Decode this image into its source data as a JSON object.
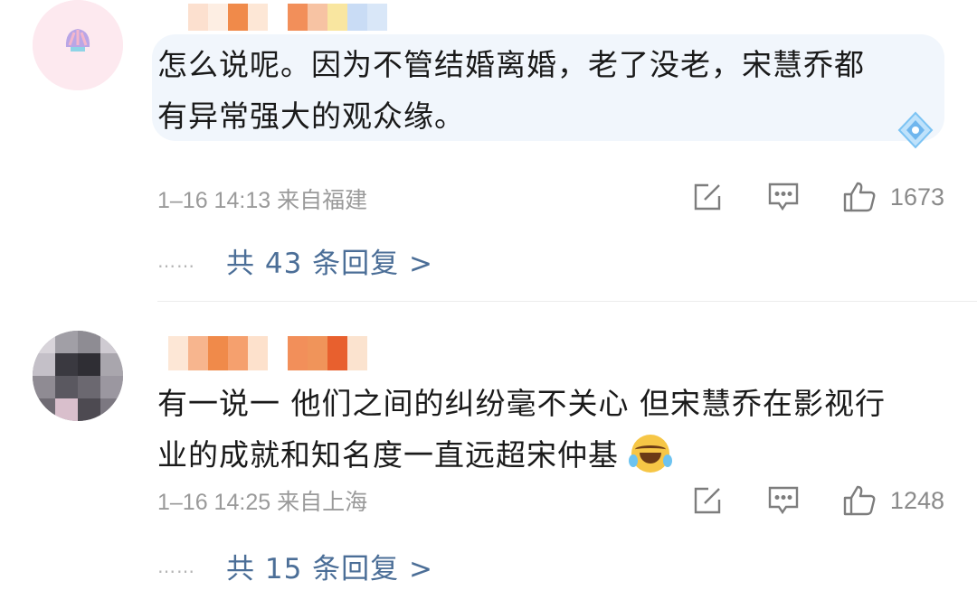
{
  "comments": [
    {
      "text_line1": "怎么说呢。因为不管结婚离婚，老了没老，宋慧乔都",
      "text_line2": "有异常强大的观众缘。",
      "meta": "1–16 14:13 来自福建",
      "likes": "1673",
      "replies": "共 43 条回复 >",
      "dots": "……"
    },
    {
      "text_line1": "有一说一 他们之间的纠纷毫不关心 但宋慧乔在影视行",
      "text_line2": "业的成就和知名度一直远超宋仲基",
      "meta": "1–16 14:25 来自上海",
      "likes": "1248",
      "replies": "共 15 条回复 >",
      "dots": "……"
    }
  ],
  "icons": {
    "repost": "share-edit-icon",
    "comment": "comment-icon",
    "like": "thumbs-up-icon",
    "badge": "diamond-badge-icon",
    "emoji": "laughing-crying-emoji"
  },
  "colors": {
    "reply_link": "#4b6e97",
    "meta_text": "#9a9a9a",
    "bubble": "#f1f6fc"
  }
}
